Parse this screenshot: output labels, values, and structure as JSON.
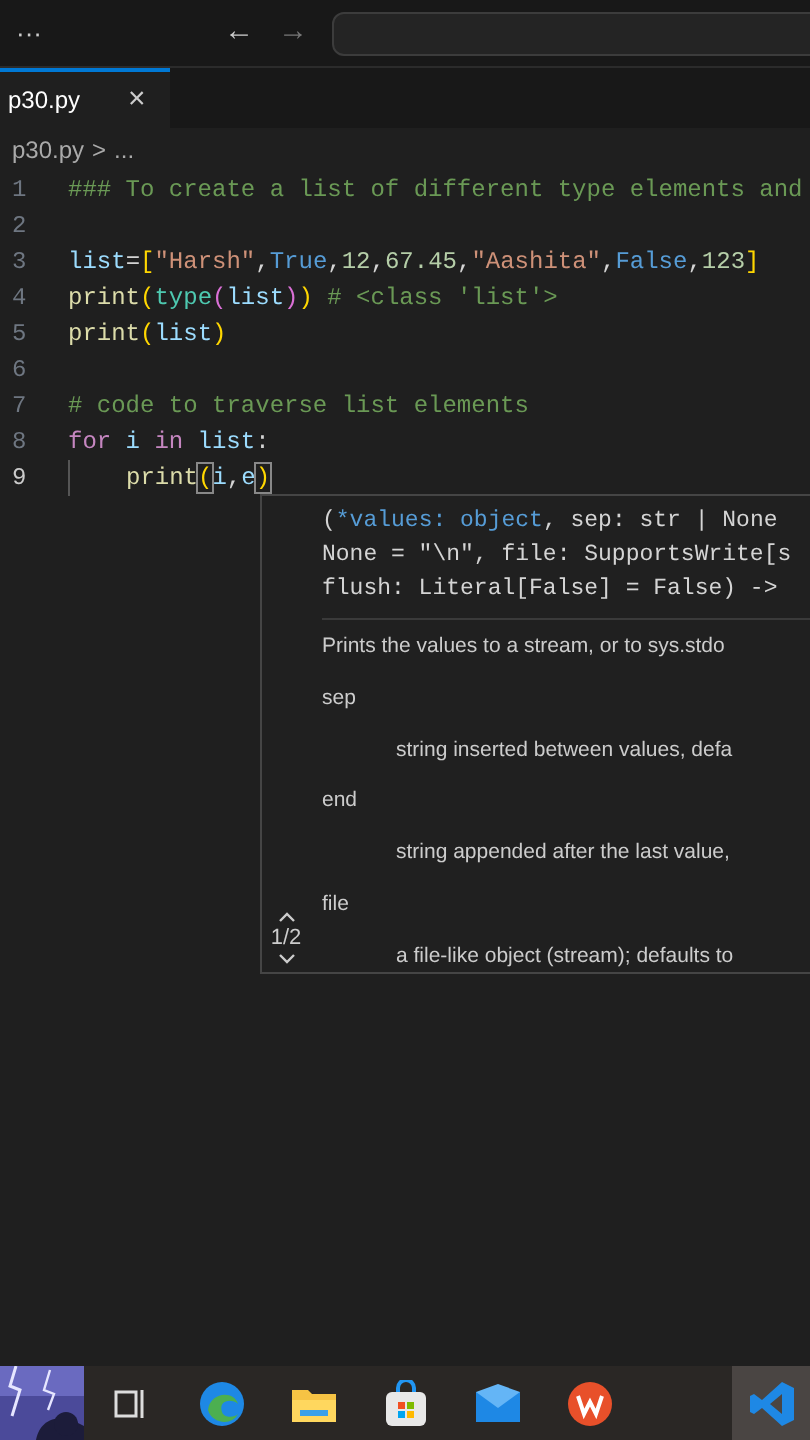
{
  "title_bar": {
    "menu": "···",
    "back": "←",
    "forward": "→"
  },
  "tabs": [
    {
      "label": "p30.py",
      "close": "×",
      "selected": true
    }
  ],
  "breadcrumb": {
    "file": "p30.py",
    "separator": ">",
    "rest": "..."
  },
  "editor": {
    "lines": [
      {
        "number": "1",
        "indent": false,
        "tokens": [
          {
            "kind": "comment",
            "text": "### To create a list of different type elements and"
          }
        ]
      },
      {
        "number": "2",
        "indent": false
      },
      {
        "number": "3",
        "indent": false,
        "tokens": [
          {
            "kind": "var",
            "text": "list"
          },
          {
            "kind": "plain",
            "text": "="
          },
          {
            "kind": "bracket",
            "text": "["
          },
          {
            "kind": "string",
            "text": "\"Harsh\""
          },
          {
            "kind": "plain",
            "text": ","
          },
          {
            "kind": "const",
            "text": "True"
          },
          {
            "kind": "plain",
            "text": ","
          },
          {
            "kind": "number",
            "text": "12"
          },
          {
            "kind": "plain",
            "text": ","
          },
          {
            "kind": "number",
            "text": "67.45"
          },
          {
            "kind": "plain",
            "text": ","
          },
          {
            "kind": "string",
            "text": "\"Aashita\""
          },
          {
            "kind": "plain",
            "text": ","
          },
          {
            "kind": "const",
            "text": "False"
          },
          {
            "kind": "plain",
            "text": ","
          },
          {
            "kind": "number",
            "text": "123"
          },
          {
            "kind": "bracket",
            "text": "]"
          }
        ]
      },
      {
        "number": "4",
        "indent": false,
        "tokens": [
          {
            "kind": "func",
            "text": "print"
          },
          {
            "kind": "bracket",
            "text": "("
          },
          {
            "kind": "builtin",
            "text": "type"
          },
          {
            "kind": "paren",
            "text": "("
          },
          {
            "kind": "var",
            "text": "list"
          },
          {
            "kind": "paren",
            "text": ")"
          },
          {
            "kind": "bracket",
            "text": ")"
          },
          {
            "kind": "comment",
            "text": "# <class 'list'>",
            "gap": true
          }
        ]
      },
      {
        "number": "5",
        "indent": false,
        "tokens": [
          {
            "kind": "func",
            "text": "print"
          },
          {
            "kind": "bracket",
            "text": "("
          },
          {
            "kind": "var",
            "text": "list"
          },
          {
            "kind": "bracket",
            "text": ")"
          }
        ]
      },
      {
        "number": "6",
        "indent": false
      },
      {
        "number": "7",
        "indent": false,
        "tokens": [
          {
            "kind": "comment",
            "text": "# code to traverse list elements"
          }
        ]
      },
      {
        "number": "8",
        "indent": false,
        "tokens": [
          {
            "kind": "keyword",
            "text": "for"
          },
          {
            "kind": "var",
            "text": "i",
            "gap": true
          },
          {
            "kind": "keyword",
            "text": "in",
            "gap": true
          },
          {
            "kind": "var",
            "text": "list",
            "gap": true
          },
          {
            "kind": "plain",
            "text": ":"
          }
        ]
      },
      {
        "number": "9",
        "indent": true,
        "tokens": [
          {
            "kind": "func",
            "text": "print"
          },
          {
            "kind": "match",
            "text": "("
          },
          {
            "kind": "var",
            "text": "i"
          },
          {
            "kind": "plain",
            "text": ","
          },
          {
            "kind": "var",
            "text": "e"
          },
          {
            "kind": "match",
            "text": ")"
          }
        ]
      }
    ]
  },
  "hover": {
    "signature": [
      [
        {
          "kind": "plain",
          "text": "("
        },
        {
          "kind": "param",
          "text": "*values: object"
        },
        {
          "kind": "plain",
          "text": ", sep: str | None"
        }
      ],
      [
        {
          "kind": "plain",
          "text": "None = \"\\n\", file: SupportsWrite[s"
        }
      ],
      [
        {
          "kind": "plain",
          "text": "flush: Literal[False] = False) ->"
        }
      ]
    ],
    "summary": "Prints the values to a stream, or to sys.stdo",
    "params": [
      {
        "name": "sep",
        "text": "string inserted between values, defa"
      },
      {
        "name": "end",
        "text": "string appended after the last value,"
      },
      {
        "name": "file",
        "text": "a file-like object (stream); defaults to"
      }
    ],
    "pager": "1/2"
  },
  "taskbar": {
    "apps": [
      {
        "kind": "taskview",
        "active": false
      },
      {
        "kind": "edge",
        "active": false
      },
      {
        "kind": "explorer",
        "active": false
      },
      {
        "kind": "store",
        "active": false
      },
      {
        "kind": "mail",
        "active": false
      },
      {
        "kind": "wps",
        "active": false
      },
      {
        "kind": "vscode",
        "active": true
      }
    ]
  }
}
